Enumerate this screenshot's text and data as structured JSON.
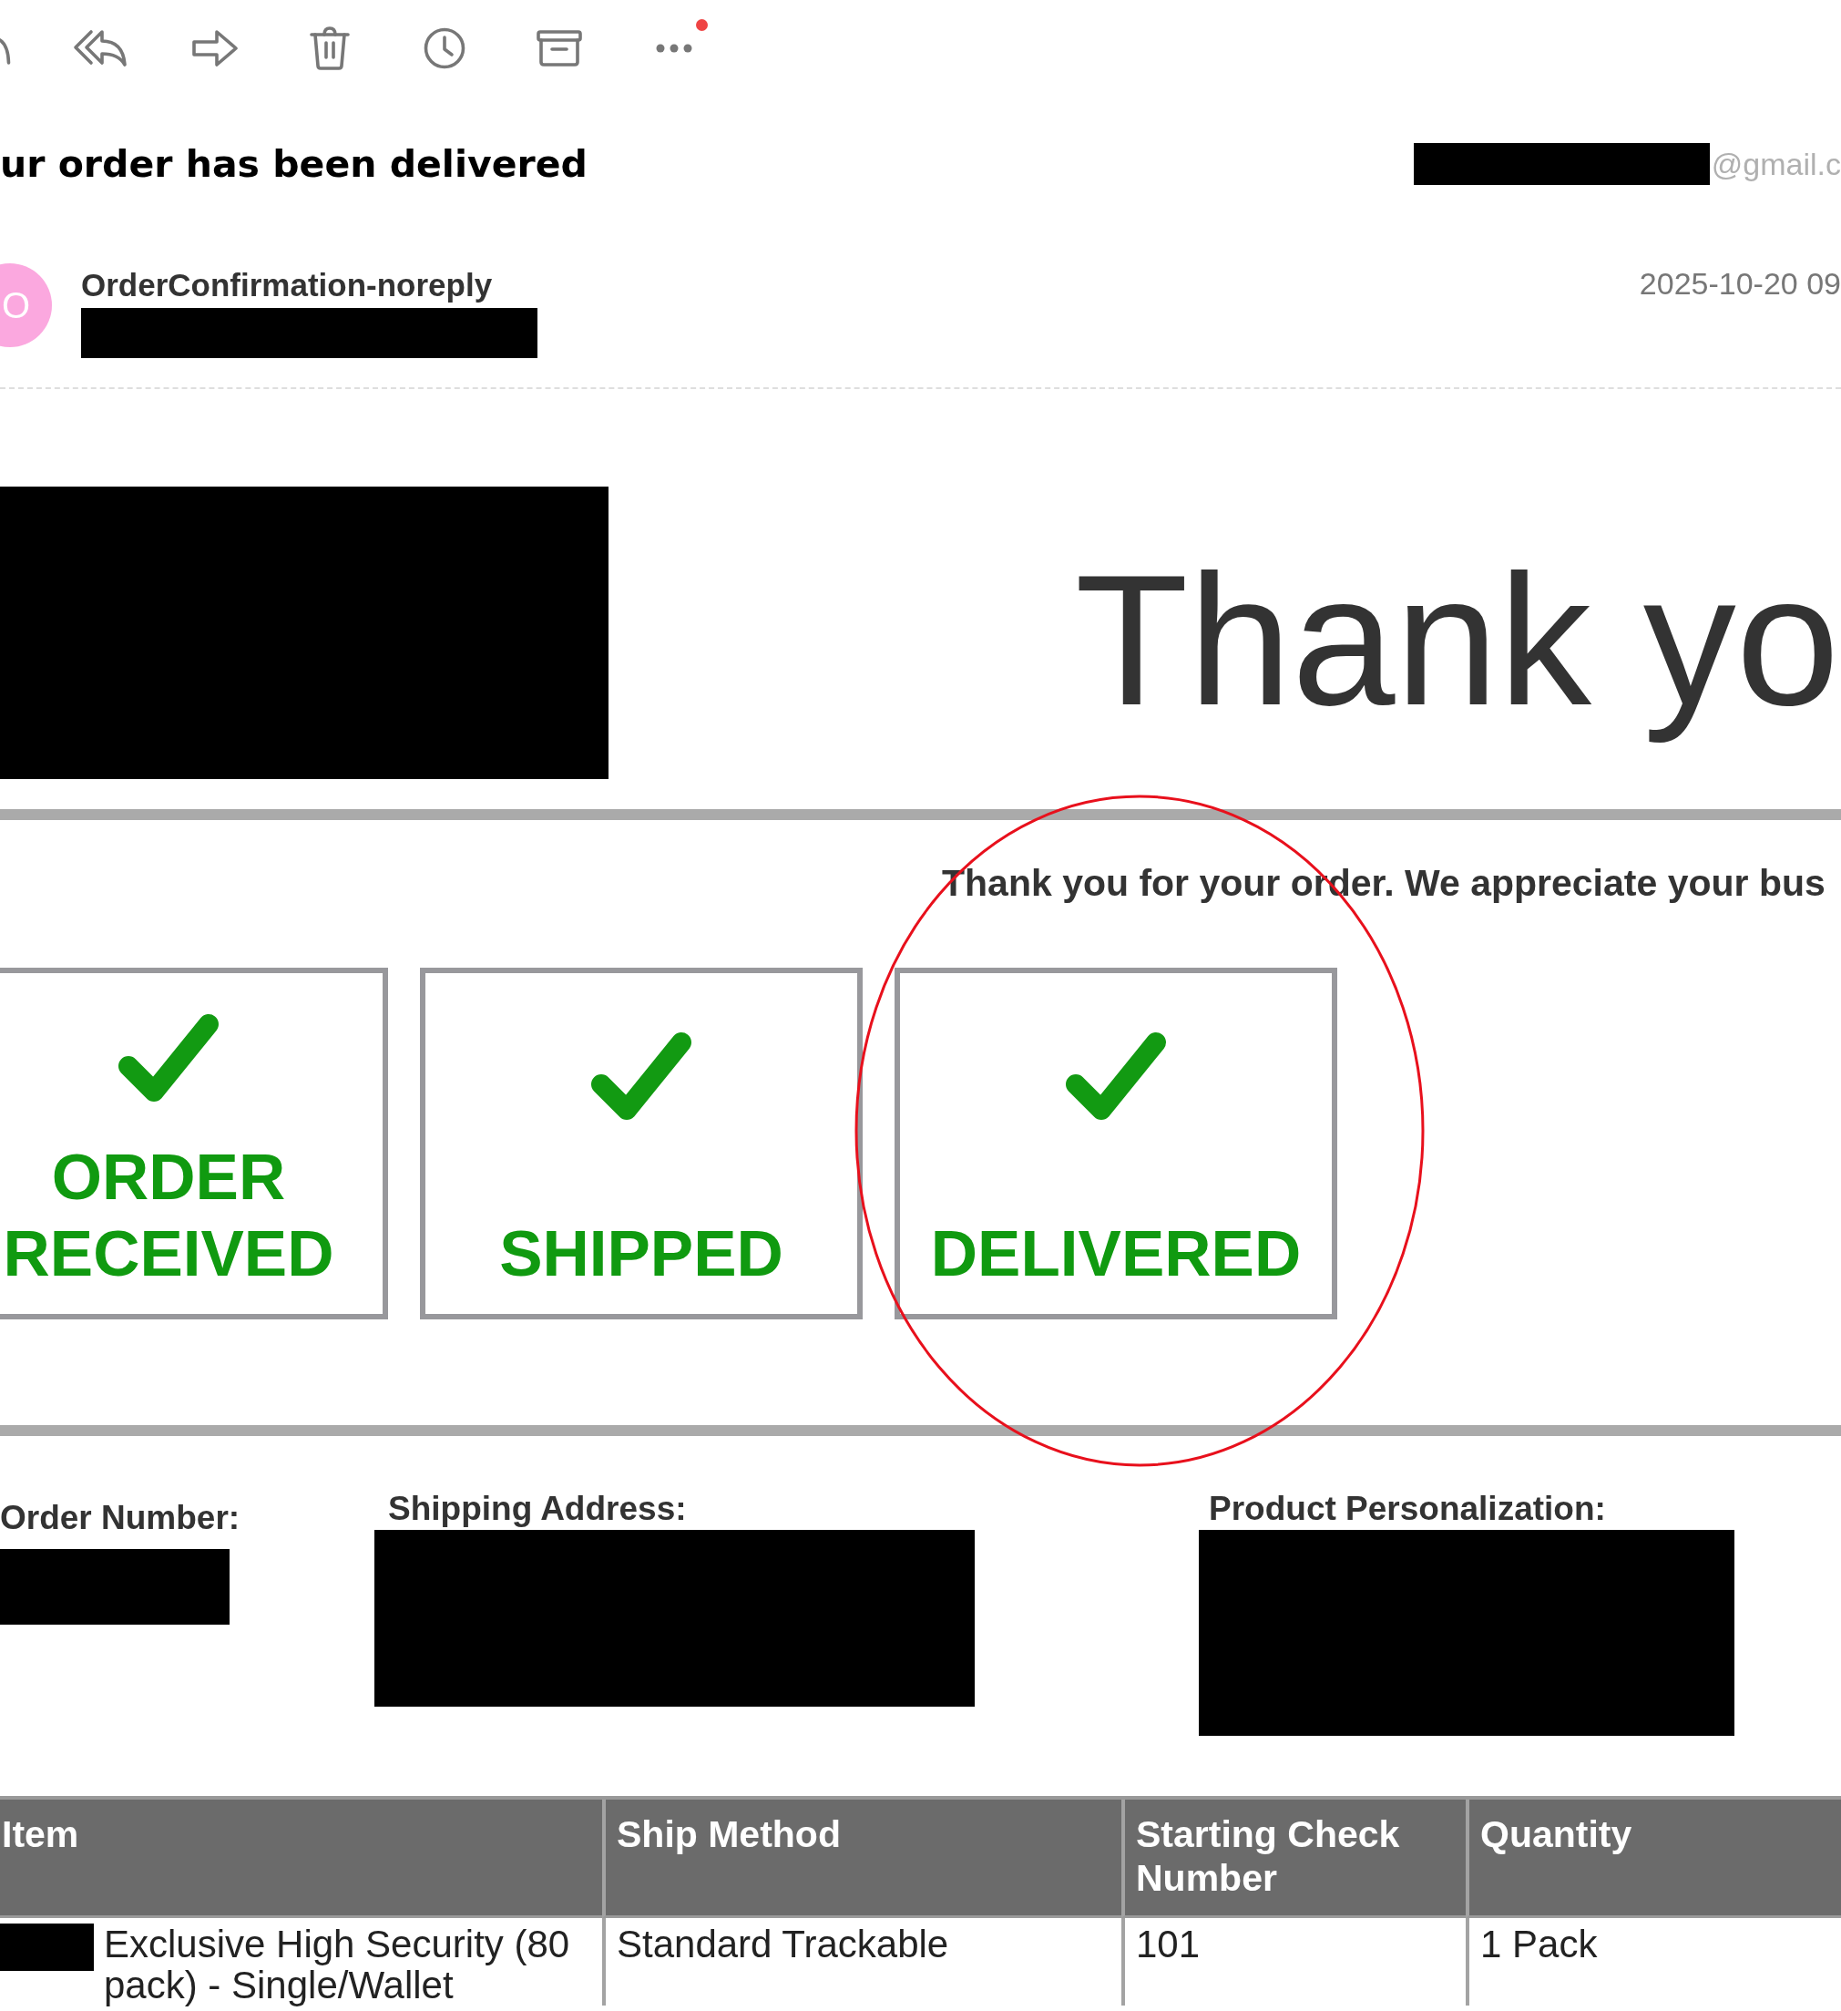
{
  "toolbar": {
    "more_badge": true
  },
  "message": {
    "subject": "ur order has been delivered",
    "recipient": "@gmail.c",
    "sender": {
      "avatar": "O",
      "name": "OrderConfirmation-noreply"
    },
    "date": "2025-10-20 09"
  },
  "body": {
    "headline": "Thank yo",
    "intro": "Thank you for your order. We appreciate your bus",
    "steps": [
      {
        "label": "ORDER RECEIVED",
        "done": true
      },
      {
        "label": "SHIPPED",
        "done": true
      },
      {
        "label": "DELIVERED",
        "done": true
      }
    ],
    "details": [
      {
        "label": "Order Number:"
      },
      {
        "label": "Shipping Address:"
      },
      {
        "label": "Product Personalization:"
      }
    ],
    "table": {
      "columns": [
        "Item",
        "Ship Method",
        "Starting Check Number",
        "Quantity"
      ],
      "rows": [
        [
          "Exclusive High Security (80 pack) - Single/Wallet",
          "Standard Trackable",
          "101",
          "1 Pack"
        ]
      ]
    }
  }
}
